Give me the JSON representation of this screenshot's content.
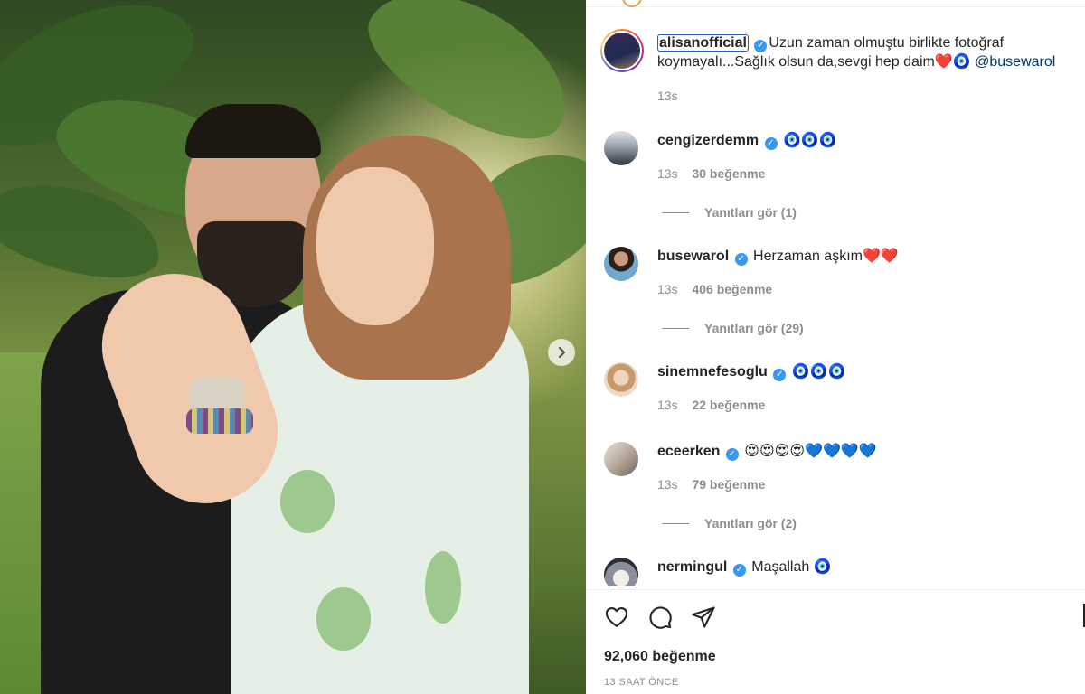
{
  "post": {
    "author": "alisanofficial",
    "caption": "Uzun zaman olmuştu birlikte fotoğraf koymayalı...Sağlık olsun da,sevgi hep daim❤️🧿",
    "mention": "@busewarol",
    "time": "13s"
  },
  "comments": [
    {
      "user": "cengizerdemm",
      "text": "🧿🧿🧿",
      "time": "13s",
      "likes": "30 beğenme",
      "replies": "Yanıtları gör (1)",
      "avatar_color": "#6a6f78"
    },
    {
      "user": "busewarol",
      "text": "Herzaman aşkım❤️❤️",
      "time": "13s",
      "likes": "406 beğenme",
      "replies": "Yanıtları gör (29)",
      "avatar_color": "#4a7fa8"
    },
    {
      "user": "sinemnefesoglu",
      "text": "🧿🧿🧿",
      "time": "13s",
      "likes": "22 beğenme",
      "replies": "",
      "avatar_color": "#e2c0a4"
    },
    {
      "user": "eceerken",
      "text": "😍😍😍😍💙💙💙💙",
      "time": "13s",
      "likes": "79 beğenme",
      "replies": "Yanıtları gör (2)",
      "avatar_color": "#b8b0a8"
    },
    {
      "user": "nermingul",
      "text": "Maşallah 🧿",
      "time": "",
      "likes": "",
      "replies": "",
      "avatar_color": "#c9c9cf"
    }
  ],
  "footer": {
    "likes": "92,060 beğenme",
    "time_ago": "13 SAAT ÖNCE"
  },
  "icons": {
    "like": "heart-icon",
    "comment": "comment-icon",
    "share": "share-icon",
    "next": "chevron-right-icon",
    "verified": "verified-badge-icon"
  },
  "colors": {
    "verified": "#3897f0",
    "mention": "#00376b",
    "muted": "#8e8e8e"
  }
}
